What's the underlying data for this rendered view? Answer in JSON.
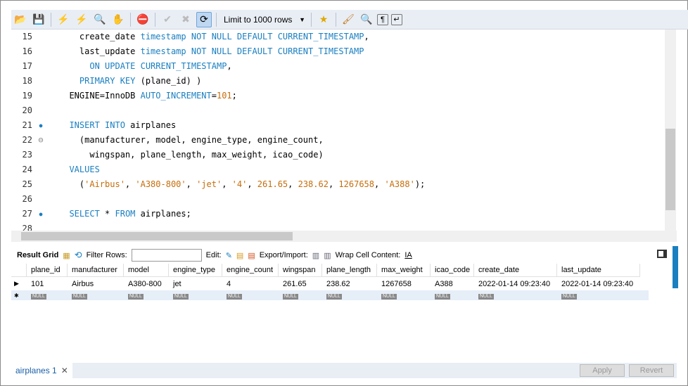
{
  "toolbar": {
    "limit_label": "Limit to 1000 rows",
    "icons": [
      "open-folder-icon",
      "save-icon",
      "execute-icon",
      "execute-current-icon",
      "explain-icon",
      "stop-icon",
      "toggle-continue-icon",
      "commit-icon",
      "rollback-icon",
      "autocommit-icon",
      "favorite-icon",
      "beautify-icon",
      "find-icon",
      "invisible-chars-icon",
      "wrap-icon"
    ]
  },
  "editor": {
    "lines": [
      {
        "n": "15",
        "m": "",
        "h": "    <span class='kw-none'>create_date</span> <span class='kw'>timestamp NOT NULL DEFAULT CURRENT_TIMESTAMP</span>,"
      },
      {
        "n": "16",
        "m": "",
        "h": "    last_update <span class='kw'>timestamp NOT NULL DEFAULT CURRENT_TIMESTAMP</span>"
      },
      {
        "n": "17",
        "m": "",
        "h": "      <span class='kw'>ON UPDATE CURRENT_TIMESTAMP</span>,"
      },
      {
        "n": "18",
        "m": "",
        "h": "    <span class='kw'>PRIMARY KEY</span> (plane_id) )"
      },
      {
        "n": "19",
        "m": "",
        "h": "  ENGINE=InnoDB <span class='kw'>AUTO_INCREMENT</span>=<span class='num'>101</span>;"
      },
      {
        "n": "20",
        "m": "",
        "h": ""
      },
      {
        "n": "21",
        "m": "dot",
        "h": "  <span class='kw'>INSERT INTO</span> airplanes"
      },
      {
        "n": "22",
        "m": "fold",
        "h": "    (manufacturer, model, engine_type, engine_count,"
      },
      {
        "n": "23",
        "m": "",
        "h": "      wingspan, plane_length, max_weight, icao_code)"
      },
      {
        "n": "24",
        "m": "",
        "h": "  <span class='kw'>VALUES</span>"
      },
      {
        "n": "25",
        "m": "",
        "h": "    (<span class='str'>'Airbus'</span>, <span class='str'>'A380-800'</span>, <span class='str'>'jet'</span>, <span class='str'>'4'</span>, <span class='num'>261.65</span>, <span class='num'>238.62</span>, <span class='num'>1267658</span>, <span class='str'>'A388'</span>);"
      },
      {
        "n": "26",
        "m": "",
        "h": ""
      },
      {
        "n": "27",
        "m": "dot",
        "h": "  <span class='kw'>SELECT</span> * <span class='kw'>FROM</span> airplanes;"
      },
      {
        "n": "28",
        "m": "",
        "h": ""
      }
    ]
  },
  "results": {
    "result_grid_label": "Result Grid",
    "filter_label": "Filter Rows:",
    "edit_label": "Edit:",
    "export_label": "Export/Import:",
    "wrap_label": "Wrap Cell Content:",
    "columns": [
      "plane_id",
      "manufacturer",
      "model",
      "engine_type",
      "engine_count",
      "wingspan",
      "plane_length",
      "max_weight",
      "icao_code",
      "create_date",
      "last_update"
    ],
    "rows": [
      [
        "101",
        "Airbus",
        "A380-800",
        "jet",
        "4",
        "261.65",
        "238.62",
        "1267658",
        "A388",
        "2022-01-14 09:23:40",
        "2022-01-14 09:23:40"
      ]
    ],
    "null_label": "NULL"
  },
  "footer": {
    "tab_label": "airplanes 1",
    "apply_label": "Apply",
    "revert_label": "Revert"
  }
}
